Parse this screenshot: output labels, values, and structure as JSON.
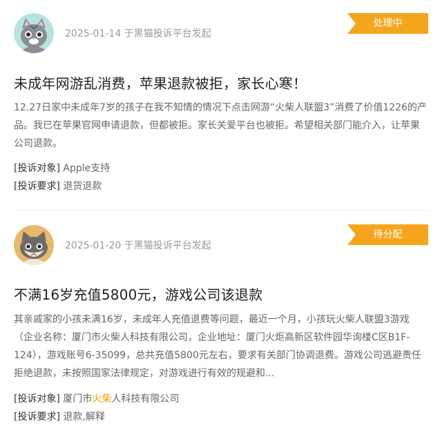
{
  "complaints": [
    {
      "avatar": "gray-cat-avatar",
      "avatar_bg": "#b9e3de",
      "meta": "2025-01-14 于黑猫投诉平台发起",
      "status": "处理中",
      "title": "未成年网游乱消费，苹果退款被拒，家长心寒！",
      "description": "12.27日家中未成年7岁的孩子在我不知情的情况下点击网游“火柴人联盟3”消费了价值1226的产品。我已在苹果官网申请退款，但都被拒。家长关爱平台也被拒。希望相关部门能介入，让苹果公司退款。",
      "target_label": "[投诉对象]",
      "target_value": "Apple支持",
      "request_label": "[投诉要求]",
      "request_value": "退货退款"
    },
    {
      "avatar": "gray-cat-avatar",
      "avatar_bg": "#e8b96a",
      "meta": "2025-01-20 于黑猫投诉平台发起",
      "status": "待分配",
      "title": "不满16岁充值5800元，游戏公司该退款",
      "description": "其亲戚家的小孩未满16岁，未成年人充值退费等问题，最近一个月，小孩玩火柴人联盟3游戏（企业名称：厦门市火柴人科技有限公司，企业地址：厦门火炬高新区软件园华询楼C区B1F-124），游戏账号6-35099，总共充值5800元左右，要求有关部门协调退费。游戏公司逃避责任拒绝退款，未按照国家法律规定，对游戏进行有效的规避和...",
      "target_label": "[投诉对象]",
      "target_value_prefix": "厦门市",
      "target_value_highlight": "火柴",
      "target_value_suffix": "人科技有限公司",
      "request_label": "[投诉要求]",
      "request_value": "退款,解释"
    }
  ],
  "colors": {
    "badge": "#f5a51c",
    "highlight": "#f39800"
  }
}
